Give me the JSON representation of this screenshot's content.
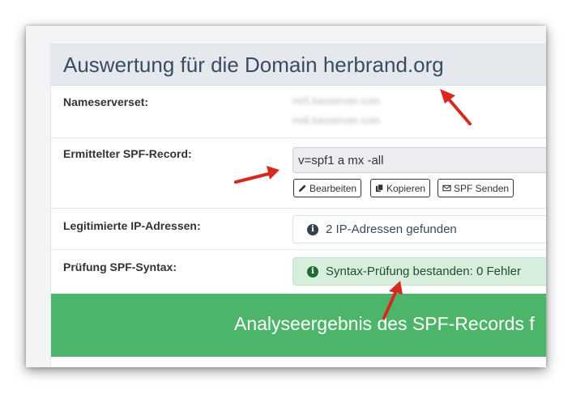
{
  "panel": {
    "title": "Auswertung für die Domain herbrand.org"
  },
  "rows": {
    "nameserver": {
      "label": "Nameserverset:",
      "values": [
        "ns5.kasserver.com",
        "ns6.kasserver.com"
      ]
    },
    "spf": {
      "label": "Ermittelter SPF-Record:",
      "value": "v=spf1 a mx -all",
      "buttons": {
        "edit": "Bearbeiten",
        "copy": "Kopieren",
        "send": "SPF Senden"
      }
    },
    "ips": {
      "label": "Legitimierte IP-Adressen:",
      "value": "2 IP-Adressen gefunden"
    },
    "syntax": {
      "label": "Prüfung SPF-Syntax:",
      "value": "Syntax-Prüfung bestanden: 0 Fehler"
    }
  },
  "result": {
    "text": "Analyseergebnis des SPF-Records f"
  },
  "icons": {
    "info": "info-circle-icon",
    "edit": "pencil-icon",
    "copy": "copy-icon",
    "send": "envelope-icon",
    "annotation": "red-arrow-icon"
  },
  "colors": {
    "header_bg": "#e5e8ec",
    "title": "#3b4c61",
    "success_bg": "#d7eedd",
    "result_bar": "#4db56a",
    "annotation_arrow": "#d42a20"
  }
}
